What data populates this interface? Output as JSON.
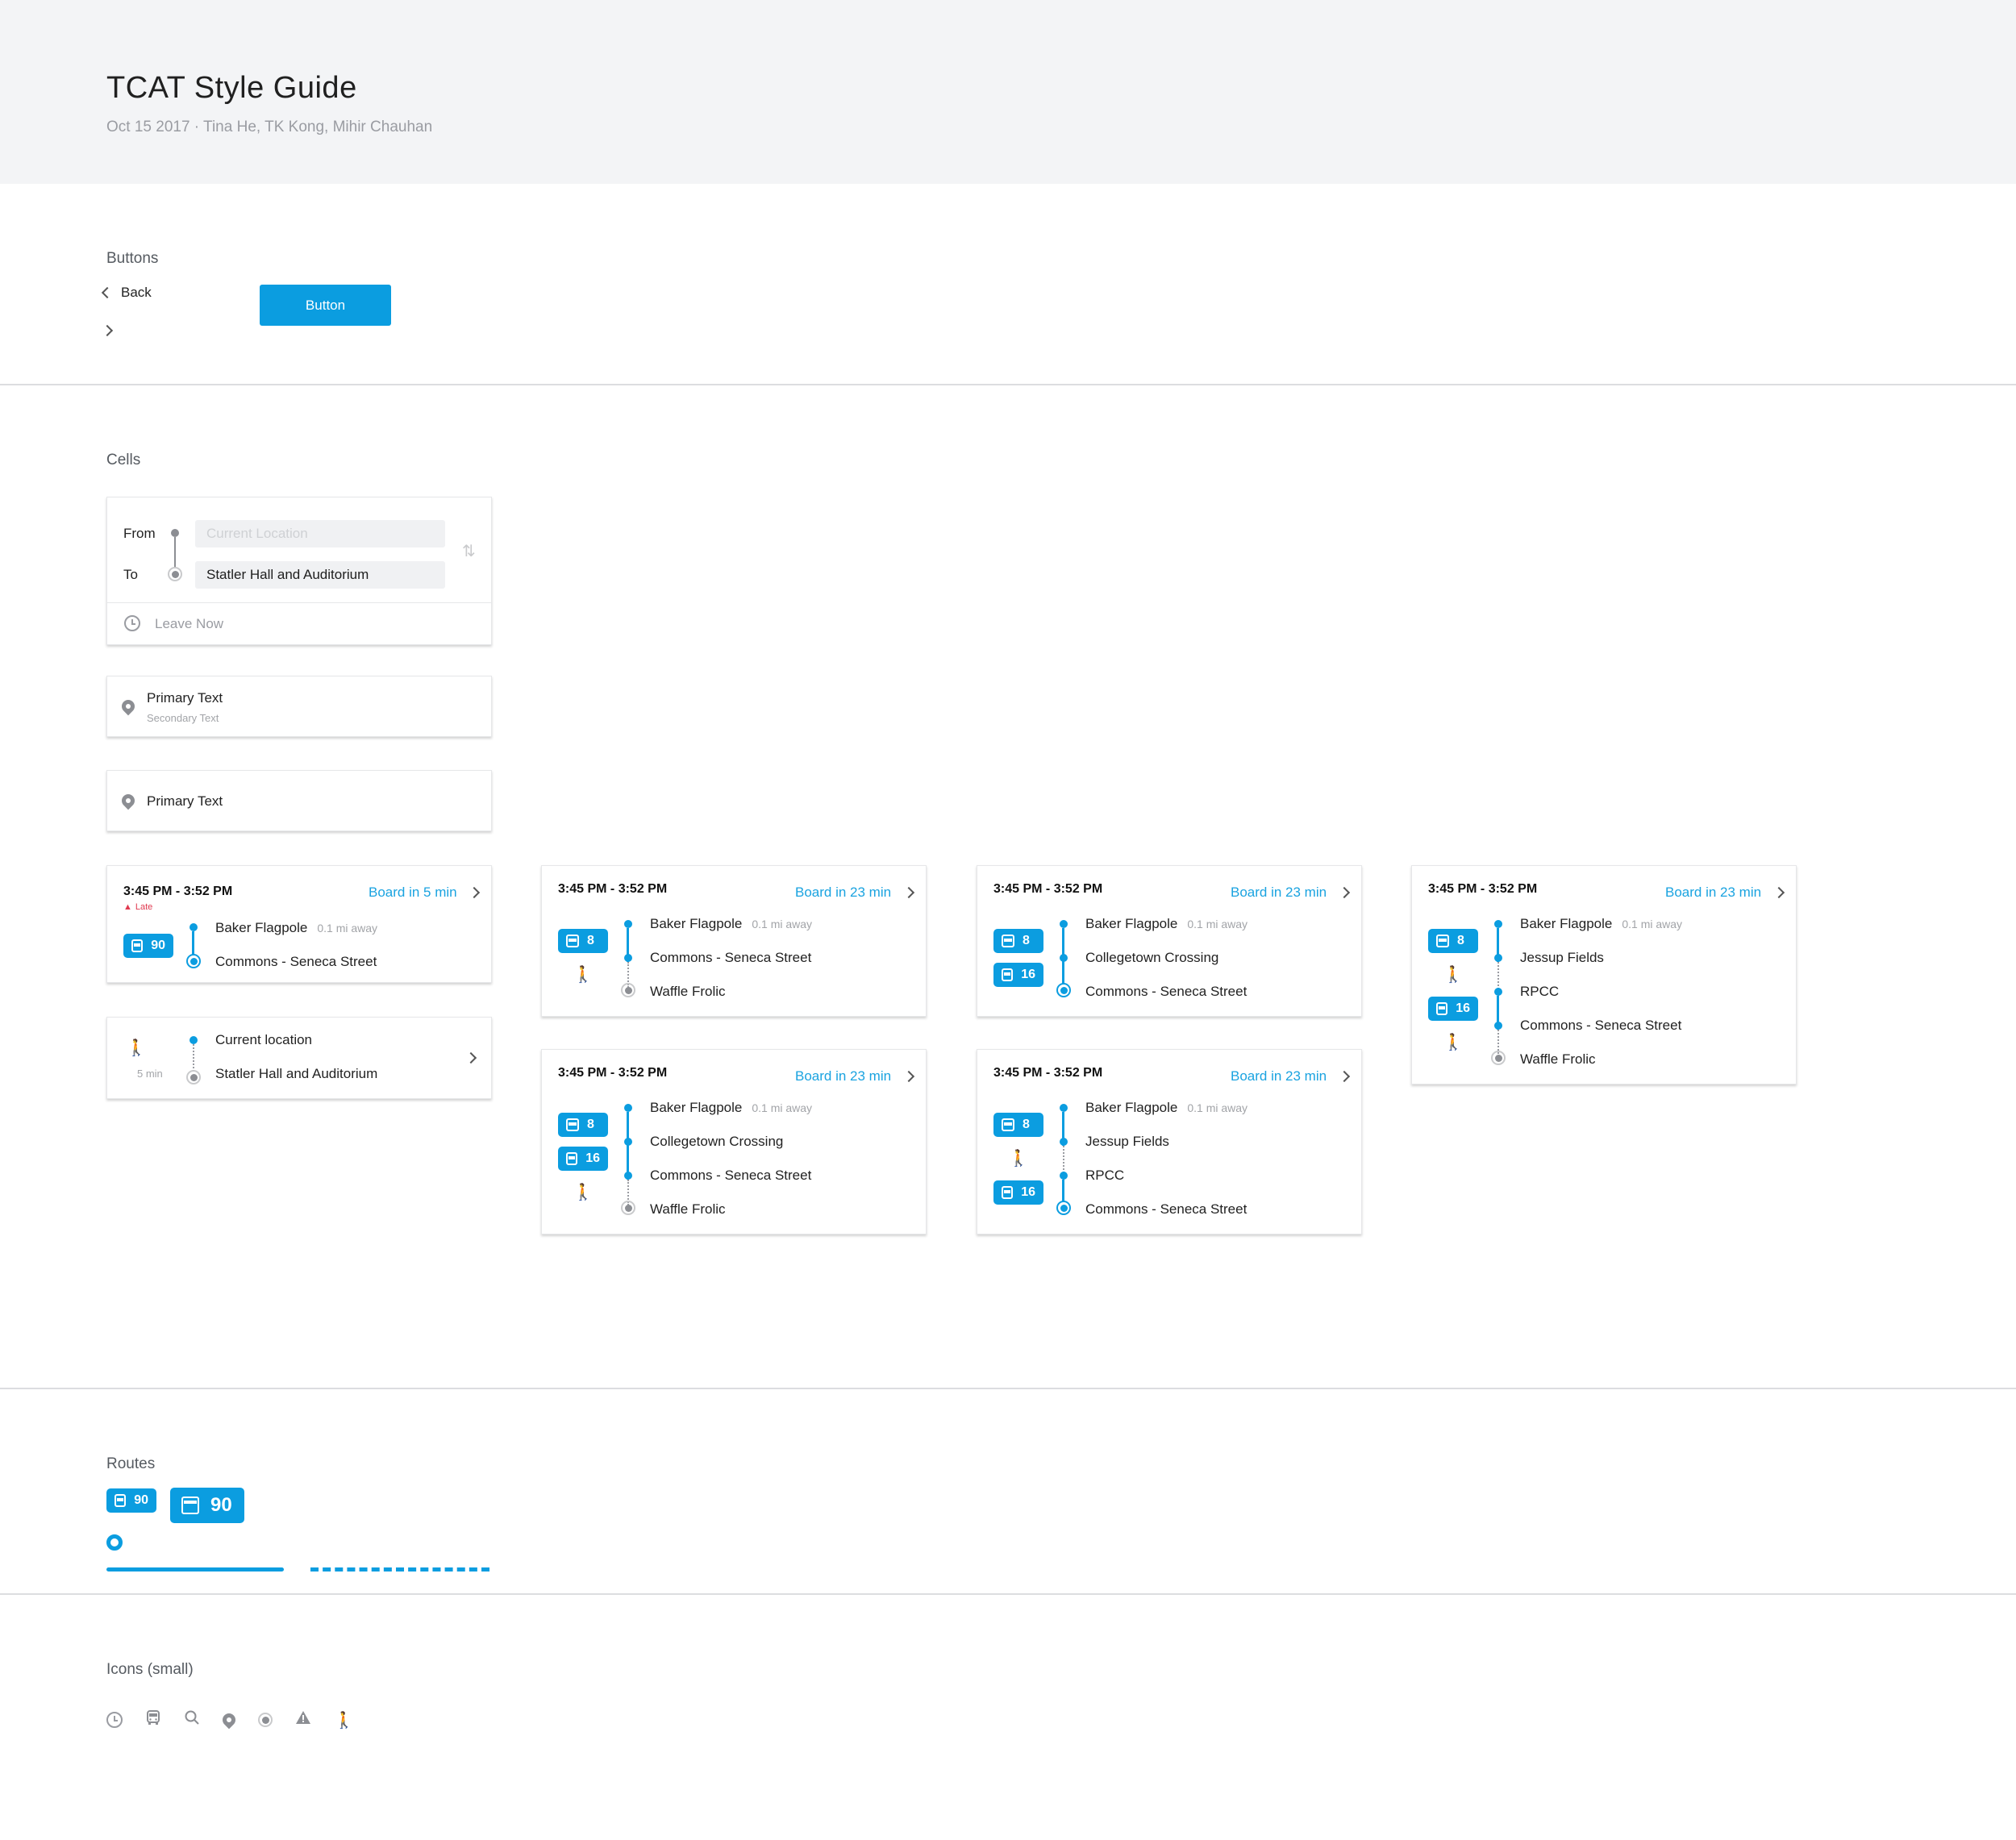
{
  "header": {
    "title": "TCAT Style Guide",
    "subtitle": "Oct 15 2017 · Tina He, TK Kong, Mihir Chauhan"
  },
  "buttons_section": {
    "label": "Buttons",
    "back_label": "Back",
    "button_label": "Button"
  },
  "cells_section": {
    "label": "Cells",
    "search": {
      "from_label": "From",
      "to_label": "To",
      "from_placeholder": "Current Location",
      "to_value": "Statler Hall and Auditorium",
      "leave_label": "Leave Now"
    },
    "place_two_line": {
      "primary": "Primary Text",
      "secondary": "Secondary Text"
    },
    "place_one_line": {
      "primary": "Primary Text"
    },
    "walk_cell": {
      "duration": "5 min",
      "from": "Current location",
      "to": "Statler Hall and Auditorium"
    },
    "route_cells": [
      {
        "time": "3:45 PM - 3:52 PM",
        "board": "Board in 5 min",
        "late": "Late",
        "stops": [
          "Baker Flagpole",
          "Commons - Seneca Street"
        ],
        "away": "0.1 mi away",
        "routes": [
          "90"
        ]
      },
      {
        "time": "3:45 PM - 3:52 PM",
        "board": "Board in 23 min",
        "stops": [
          "Baker Flagpole",
          "Commons - Seneca Street",
          "Waffle Frolic"
        ],
        "away": "0.1 mi away",
        "routes": [
          "8"
        ]
      },
      {
        "time": "3:45 PM - 3:52 PM",
        "board": "Board in 23 min",
        "stops": [
          "Baker Flagpole",
          "Collegetown Crossing",
          "Commons - Seneca Street"
        ],
        "away": "0.1 mi away",
        "routes": [
          "8",
          "16"
        ]
      },
      {
        "time": "3:45 PM - 3:52 PM",
        "board": "Board in 23 min",
        "stops": [
          "Baker Flagpole",
          "Jessup Fields",
          "RPCC",
          "Commons - Seneca Street",
          "Waffle Frolic"
        ],
        "away": "0.1 mi away",
        "routes": [
          "8",
          "16"
        ]
      },
      {
        "time": "3:45 PM - 3:52 PM",
        "board": "Board in 23 min",
        "stops": [
          "Baker Flagpole",
          "Collegetown Crossing",
          "Commons - Seneca Street",
          "Waffle Frolic"
        ],
        "away": "0.1 mi away",
        "routes": [
          "8",
          "16"
        ]
      },
      {
        "time": "3:45 PM - 3:52 PM",
        "board": "Board in 23 min",
        "stops": [
          "Baker Flagpole",
          "Jessup Fields",
          "RPCC",
          "Commons - Seneca Street"
        ],
        "away": "0.1 mi away",
        "routes": [
          "8",
          "16"
        ]
      }
    ]
  },
  "routes_section": {
    "label": "Routes",
    "badge_small": "90",
    "badge_large": "90"
  },
  "icons_section": {
    "label": "Icons (small)",
    "icons": [
      "clock-icon",
      "bus-icon",
      "search-icon",
      "pin-icon",
      "stop-icon",
      "warning-icon",
      "walk-icon"
    ]
  },
  "colors": {
    "accent": "#0b9de0",
    "late": "#e0394f",
    "header_bg": "#f3f4f6"
  }
}
